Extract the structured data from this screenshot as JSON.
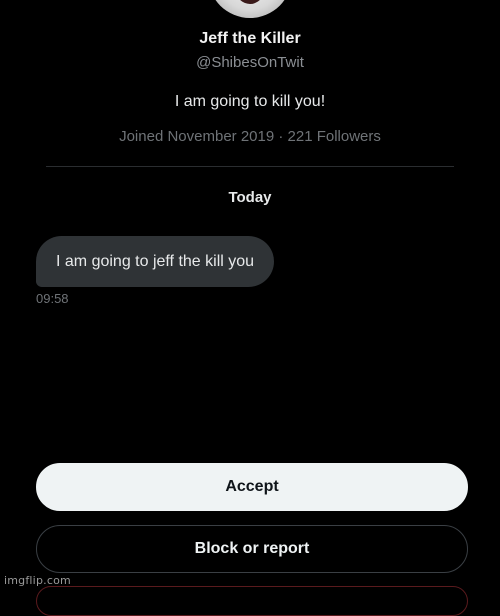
{
  "profile": {
    "name": "Jeff the Killer",
    "handle": "@ShibesOnTwit",
    "bio": "I am going to kill you!",
    "meta": "Joined November 2019 · 221 Followers"
  },
  "conversation": {
    "date_label": "Today",
    "messages": [
      {
        "text": "I am going to jeff the kill you",
        "time": "09:58"
      }
    ]
  },
  "actions": {
    "accept_label": "Accept",
    "block_label": "Block or report"
  },
  "watermark": "imgflip.com",
  "colors": {
    "background": "#000000",
    "bubble": "#2f3336",
    "primary_button": "#eff3f4",
    "secondary_text": "#6f7377",
    "danger_outline": "#5a1a1d"
  },
  "icons": {
    "avatar": "creepy-face-avatar"
  }
}
